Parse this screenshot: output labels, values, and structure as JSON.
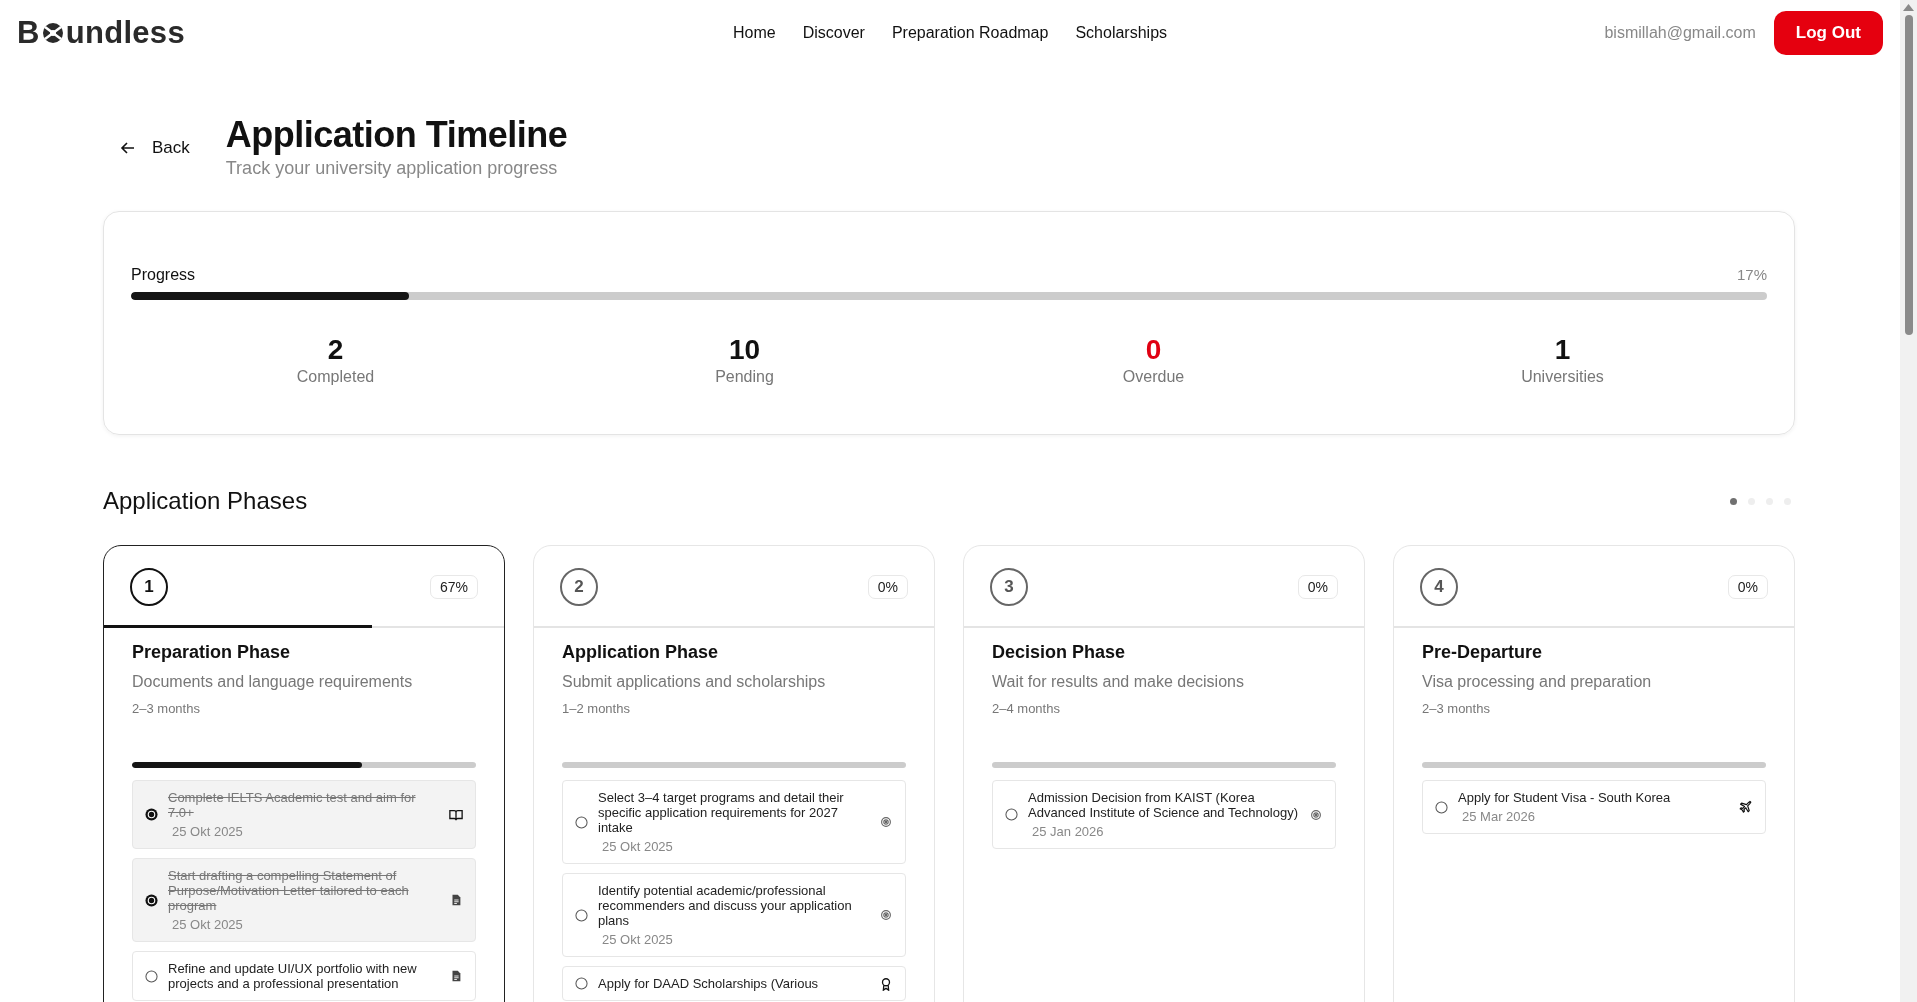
{
  "nav": {
    "logo_start": "B",
    "logo_end": "undless",
    "links": [
      {
        "label": "Home"
      },
      {
        "label": "Discover"
      },
      {
        "label": "Preparation Roadmap"
      },
      {
        "label": "Scholarships"
      }
    ],
    "email": "bismillah@gmail.com",
    "logout": "Log Out"
  },
  "header": {
    "back": "Back",
    "title": "Application Timeline",
    "subtitle": "Track your university application progress"
  },
  "progress": {
    "label": "Progress",
    "percent": "17%",
    "level": 0.17,
    "stats": [
      {
        "value": "2",
        "label": "Completed",
        "color": "#111111"
      },
      {
        "value": "10",
        "label": "Pending",
        "color": "#111111"
      },
      {
        "value": "0",
        "label": "Overdue",
        "color": "#e00012"
      },
      {
        "value": "1",
        "label": "Universities",
        "color": "#111111"
      }
    ]
  },
  "phases_title": "Application Phases",
  "pages": [
    {
      "selected": true
    },
    {
      "selected": false
    },
    {
      "selected": false
    },
    {
      "selected": false
    }
  ],
  "phases": [
    {
      "number": "1",
      "percent": "67%",
      "title": "Preparation Phase",
      "description": "Documents and language requirements",
      "duration": "2–3 months",
      "level": 0.67,
      "selected": true,
      "tasks": [
        {
          "text": "Complete IELTS Academic test and aim for 7.0+",
          "date": "25 Okt 2025",
          "done": true,
          "kind": "book"
        },
        {
          "text": "Start drafting a compelling Statement of Purpose/Motivation Letter tailored to each program",
          "date": "25 Okt 2025",
          "done": true,
          "kind": "document"
        },
        {
          "text": "Refine and update UI/UX portfolio with new projects and a professional presentation",
          "done": false,
          "kind": "document"
        }
      ]
    },
    {
      "number": "2",
      "percent": "0%",
      "title": "Application Phase",
      "description": "Submit applications and scholarships",
      "duration": "1–2 months",
      "level": 0,
      "selected": false,
      "tasks": [
        {
          "text": "Select 3–4 target programs and detail their specific application requirements for 2027 intake",
          "date": "25 Okt 2025",
          "done": false,
          "kind": "target"
        },
        {
          "text": "Identify potential academic/professional recommenders and discuss your application plans",
          "date": "25 Okt 2025",
          "done": false,
          "kind": "target"
        },
        {
          "text": "Apply for DAAD Scholarships (Various",
          "done": false,
          "kind": "award"
        }
      ]
    },
    {
      "number": "3",
      "percent": "0%",
      "title": "Decision Phase",
      "description": "Wait for results and make decisions",
      "duration": "2–4 months",
      "level": 0,
      "selected": false,
      "tasks": [
        {
          "text": "Admission Decision from KAIST (Korea Advanced Institute of Science and Technology)",
          "date": "25 Jan 2026",
          "done": false,
          "kind": "target"
        }
      ]
    },
    {
      "number": "4",
      "percent": "0%",
      "title": "Pre-Departure",
      "description": "Visa processing and preparation",
      "duration": "2–3 months",
      "level": 0,
      "selected": false,
      "tasks": [
        {
          "text": "Apply for Student Visa - South Korea",
          "date": "25 Mar 2026",
          "done": false,
          "kind": "plane"
        }
      ]
    }
  ]
}
